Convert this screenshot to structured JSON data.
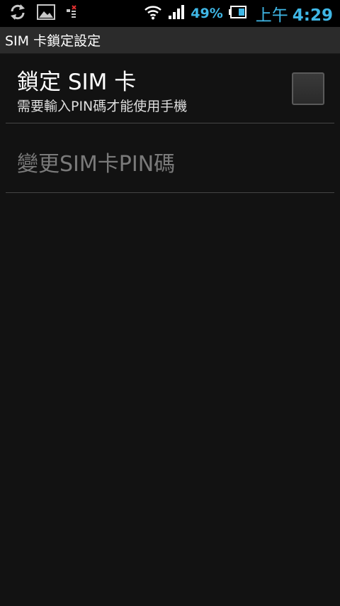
{
  "status_bar": {
    "battery_percent": "49%",
    "clock_ampm": "上午",
    "clock_time": "4:29",
    "accent_color": "#3fb7e6",
    "icons": [
      "sync-icon",
      "gallery-icon",
      "sim-error-icon",
      "wifi-icon",
      "signal-icon",
      "battery-icon"
    ]
  },
  "titlebar": {
    "title": "SIM 卡鎖定設定"
  },
  "preferences": [
    {
      "title": "鎖定 SIM 卡",
      "summary": "需要輸入PIN碼才能使用手機",
      "checked": false
    },
    {
      "title": "變更SIM卡PIN碼",
      "enabled": false
    }
  ]
}
